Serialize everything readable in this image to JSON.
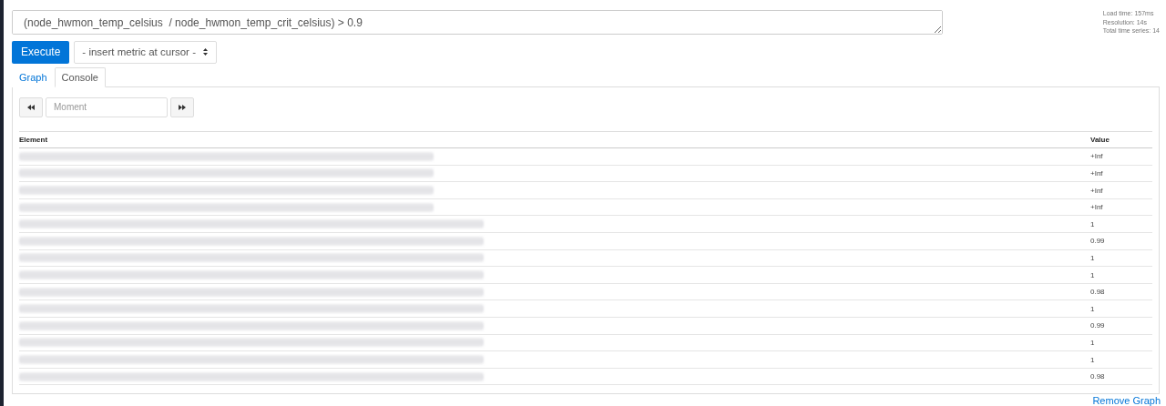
{
  "expression": {
    "value": "(node_hwmon_temp_celsius  / node_hwmon_temp_crit_celsius) > 0.9"
  },
  "stats": [
    "Load time: 157ms",
    "Resolution: 14s",
    "Total time series: 14"
  ],
  "execute_button": "Execute",
  "metric_select": {
    "value": "- insert metric at cursor -"
  },
  "tabs": [
    {
      "label": "Graph",
      "selected": false
    },
    {
      "label": "Console",
      "selected": true
    }
  ],
  "moment": {
    "placeholder": "Moment"
  },
  "table": {
    "columns": [
      "Element",
      "Value"
    ],
    "rows": [
      {
        "kind": "short",
        "value": "+Inf"
      },
      {
        "kind": "short",
        "value": "+Inf"
      },
      {
        "kind": "short",
        "value": "+Inf"
      },
      {
        "kind": "short",
        "value": "+Inf"
      },
      {
        "kind": "long",
        "value": "1"
      },
      {
        "kind": "long",
        "value": "0.99"
      },
      {
        "kind": "long",
        "value": "1"
      },
      {
        "kind": "long",
        "value": "1"
      },
      {
        "kind": "long",
        "value": "0.98"
      },
      {
        "kind": "long",
        "value": "1"
      },
      {
        "kind": "long",
        "value": "0.99"
      },
      {
        "kind": "long",
        "value": "1"
      },
      {
        "kind": "long",
        "value": "1"
      },
      {
        "kind": "long",
        "value": "0.98"
      }
    ]
  },
  "remove_link": "Remove Graph"
}
